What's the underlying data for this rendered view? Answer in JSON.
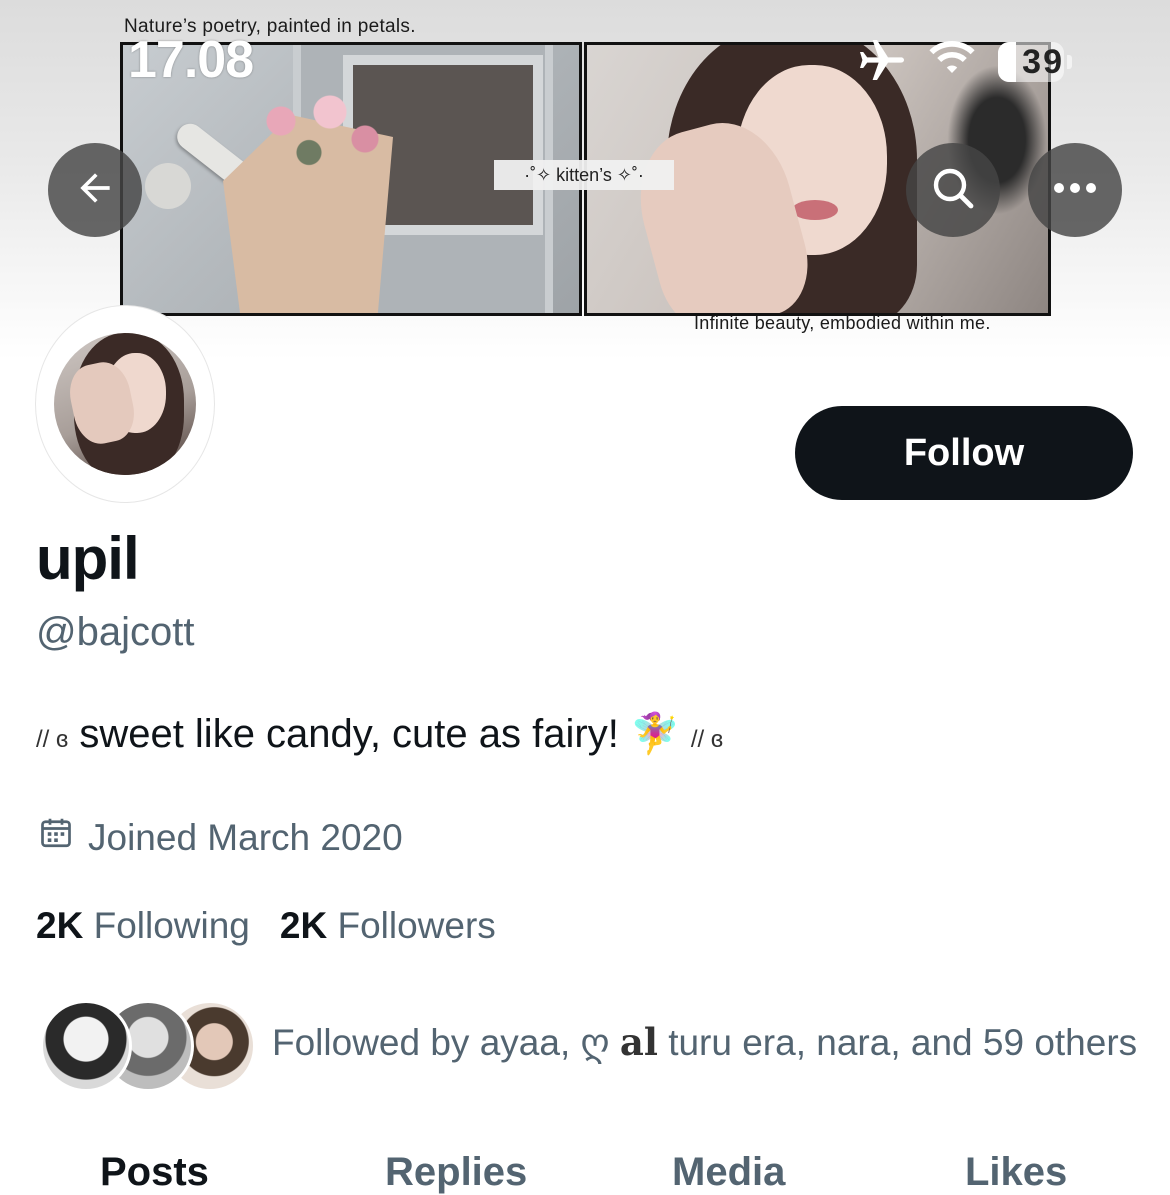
{
  "status": {
    "time": "17.08",
    "battery": "39"
  },
  "banner": {
    "caption_top": "Nature’s poetry, painted in petals.",
    "caption_bottom": "Infinite beauty, embodied within me.",
    "center_label": "·˚✧ kitten’s ✧˚·"
  },
  "icons": {
    "back": "arrow-left-icon",
    "search": "search-icon",
    "more": "more-horizontal-icon",
    "calendar": "calendar-icon",
    "airplane": "airplane-icon",
    "wifi": "wifi-icon",
    "battery": "battery-icon"
  },
  "profile": {
    "follow_label": "Follow",
    "display_name": "upil",
    "handle": "@bajcott",
    "bio_prefix": "// ɞ",
    "bio_text": "sweet like candy, cute as fairy!",
    "bio_emoji": "🧚‍♀️",
    "bio_suffix": "// ɞ",
    "joined": "Joined March 2020",
    "following_count": "2K",
    "following_label": "Following",
    "followers_count": "2K",
    "followers_label": "Followers",
    "followed_by_prefix": "Followed by ayaa, ღ",
    "followed_by_styled": "al",
    "followed_by_rest": "turu era, nara, and 59 others"
  },
  "tabs": [
    "Posts",
    "Replies",
    "Media",
    "Likes"
  ]
}
